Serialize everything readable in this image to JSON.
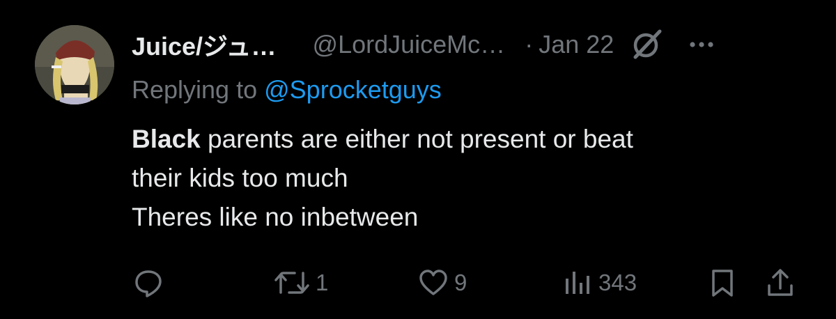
{
  "tweet": {
    "display_name": "Juice/ジュ…",
    "handle": "@LordJuiceMc…",
    "separator": "·",
    "date": "Jan 22",
    "replying_prefix": "Replying to",
    "replying_to": "@Sprocketguys",
    "body": {
      "bold_word": "Black",
      "line1_rest": " parents are either not present or beat",
      "line2": "their kids too much",
      "line3": "Theres like no inbetween"
    }
  },
  "actions": {
    "reply_count": "",
    "retweet_count": "1",
    "like_count": "9",
    "views_count": "343"
  },
  "icons": {
    "header": [
      "grok-icon",
      "more-icon"
    ],
    "actions": [
      "reply-icon",
      "retweet-icon",
      "like-icon",
      "views-icon",
      "bookmark-icon",
      "share-icon"
    ]
  },
  "colors": {
    "background": "#000000",
    "primary_text": "#e7e9ea",
    "secondary_text": "#71767b",
    "link": "#1d9bf0"
  }
}
